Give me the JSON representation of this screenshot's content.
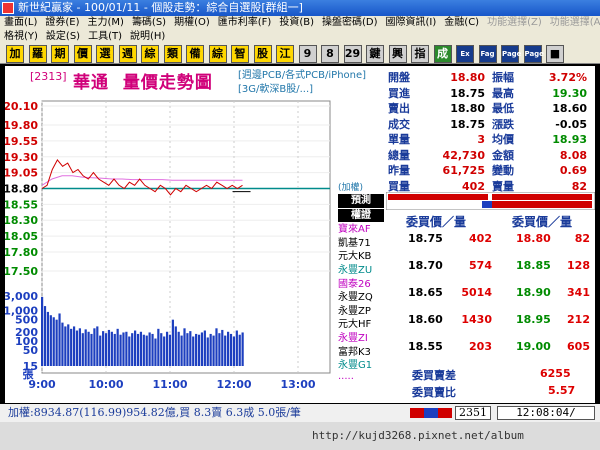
{
  "window": {
    "title": "新世紀贏家 - 100/01/11 - 個股走勢：綜合自選股[群組一]"
  },
  "menu": {
    "row1": [
      "畫面(L)",
      "證券(E)",
      "主力(M)",
      "籌碼(S)",
      "期權(O)",
      "匯市利率(F)",
      "投資(B)",
      "操盤密碼(D)",
      "國際資訊(I)",
      "金融(C)",
      "功能選擇(Z)",
      "功能選擇(A)"
    ],
    "row2": [
      "格視(Y)",
      "設定(S)",
      "工具(T)",
      "說明(H)"
    ]
  },
  "toolbar": {
    "buttons": [
      "加",
      "羅",
      "期",
      "價",
      "選",
      "週",
      "綜",
      "類",
      "備",
      "綜",
      "智",
      "股",
      "江",
      "9",
      "8",
      "29",
      "鍵",
      "興",
      "指",
      "成",
      "Ex",
      "Fag",
      "Page Up",
      "Page Down",
      "■"
    ]
  },
  "chart": {
    "code": "[2313]",
    "name": "華通",
    "title": "量價走勢圖",
    "categories": [
      "[週邊PCB/各式PCB/iPhone]",
      "[3G/軟深B股/...]"
    ],
    "marker": "(加權)",
    "volume_unit": "張",
    "legend_header": "預測",
    "legend_sub_header": "權證",
    "legend_items": [
      {
        "label": "寶來AF",
        "color": "#c000c0"
      },
      {
        "label": "凱基71",
        "color": "#000000"
      },
      {
        "label": "元大KB",
        "color": "#000000"
      },
      {
        "label": "永豐ZU",
        "color": "#008b8b"
      },
      {
        "label": "國泰26",
        "color": "#c000c0"
      },
      {
        "label": "永豐ZQ",
        "color": "#000000"
      },
      {
        "label": "永豐ZP",
        "color": "#000000"
      },
      {
        "label": "元大HF",
        "color": "#000000"
      },
      {
        "label": "永豐ZI",
        "color": "#c000c0"
      },
      {
        "label": "富邦K3",
        "color": "#000000"
      },
      {
        "label": "永豐G1",
        "color": "#008b8b"
      },
      {
        "label": "·····",
        "color": "#c000c0"
      }
    ]
  },
  "chart_data": {
    "type": "line",
    "price_ticks": [
      "20.10",
      "19.80",
      "19.55",
      "19.30",
      "19.05",
      "18.80",
      "18.55",
      "18.30",
      "18.05",
      "17.80",
      "17.50"
    ],
    "volume_ticks": [
      "3,000",
      "1,000",
      "500",
      "200",
      "100",
      "50",
      "15"
    ],
    "x_ticks": [
      "9:00",
      "10:00",
      "11:00",
      "12:00",
      "13:00"
    ],
    "reference_price": 18.8,
    "price_series": [
      18.8,
      18.85,
      19.1,
      19.25,
      19.15,
      19.2,
      19.05,
      19.1,
      19.0,
      18.95,
      19.05,
      18.95,
      18.9,
      18.85,
      18.95,
      18.85,
      18.8,
      18.9,
      18.85,
      18.95,
      18.85,
      18.8,
      18.75,
      18.85,
      18.8,
      18.7,
      18.8,
      18.75,
      18.85,
      18.8,
      18.75,
      18.8,
      18.85,
      18.8,
      18.9,
      18.85,
      18.8,
      18.85,
      18.8,
      18.85
    ],
    "avg_series": [
      18.85,
      18.95,
      19.0,
      19.0,
      18.98,
      18.97,
      18.96,
      18.95,
      18.95,
      18.94,
      18.94,
      18.94,
      18.94,
      18.93,
      18.93,
      18.93,
      18.93,
      18.93,
      18.93,
      18.93,
      18.93
    ],
    "volume_series": [
      2800,
      1400,
      900,
      700,
      600,
      500,
      800,
      400,
      300,
      350,
      250,
      300,
      220,
      260,
      180,
      240,
      200,
      170,
      260,
      300,
      150,
      210,
      180,
      230,
      200,
      170,
      250,
      160,
      190,
      200,
      140,
      180,
      220,
      170,
      200,
      160,
      150,
      190,
      170,
      120,
      250,
      180,
      140,
      200,
      160,
      500,
      300,
      200,
      150,
      260,
      180,
      210,
      140,
      170,
      160,
      190,
      220,
      130,
      170,
      150,
      260,
      180,
      230,
      150,
      200,
      170,
      140,
      220,
      160,
      190
    ]
  },
  "quote": {
    "rows": [
      {
        "l": "開盤",
        "v": "18.80",
        "vc": "#d00000",
        "l2": "振幅",
        "v2": "3.72%",
        "v2c": "#d00000"
      },
      {
        "l": "買進",
        "v": "18.75",
        "vc": "#000000",
        "l2": "最高",
        "v2": "19.30",
        "v2c": "#008b00"
      },
      {
        "l": "賣出",
        "v": "18.80",
        "vc": "#000000",
        "l2": "最低",
        "v2": "18.60",
        "v2c": "#000000"
      },
      {
        "l": "成交",
        "v": "18.75",
        "vc": "#000000",
        "l2": "漲跌",
        "v2": "-0.05",
        "v2c": "#000000"
      },
      {
        "l": "單量",
        "v": "3",
        "vc": "#d00000",
        "l2": "均價",
        "v2": "18.93",
        "v2c": "#008b00"
      },
      {
        "l": "總量",
        "v": "42,730",
        "vc": "#d00000",
        "l2": "金額",
        "v2": "8.08",
        "v2c": "#d00000"
      },
      {
        "l": "昨量",
        "v": "61,725",
        "vc": "#d00000",
        "l2": "變動",
        "v2": "0.69",
        "v2c": "#d00000"
      },
      {
        "l": "買量",
        "v": "402",
        "vc": "#d00000",
        "l2": "賣量",
        "v2": "82",
        "v2c": "#d00000"
      }
    ],
    "bid_header": "委買價／量",
    "ask_header": "委買價／量",
    "book": [
      {
        "bp": "18.75",
        "bv": "402",
        "ap": "18.80",
        "av": "82"
      },
      {
        "bp": "18.70",
        "bv": "574",
        "ap": "18.85",
        "av": "128"
      },
      {
        "bp": "18.65",
        "bv": "5014",
        "ap": "18.90",
        "av": "341"
      },
      {
        "bp": "18.60",
        "bv": "1430",
        "ap": "18.95",
        "av": "212"
      },
      {
        "bp": "18.55",
        "bv": "203",
        "ap": "19.00",
        "av": "605"
      }
    ],
    "gap_label": "委買賣差",
    "gap_value": "6255",
    "ratio_label": "委買賣比",
    "ratio_value": "5.57"
  },
  "status": {
    "text": "加權:8934.87(116.99)954.82億,買 8.3賣 6.3成 5.0張/筆",
    "count": "2351",
    "clock": "12:08:04/"
  },
  "taskbar": {
    "watermark": "http://kujd3268.pixnet.net/album"
  }
}
